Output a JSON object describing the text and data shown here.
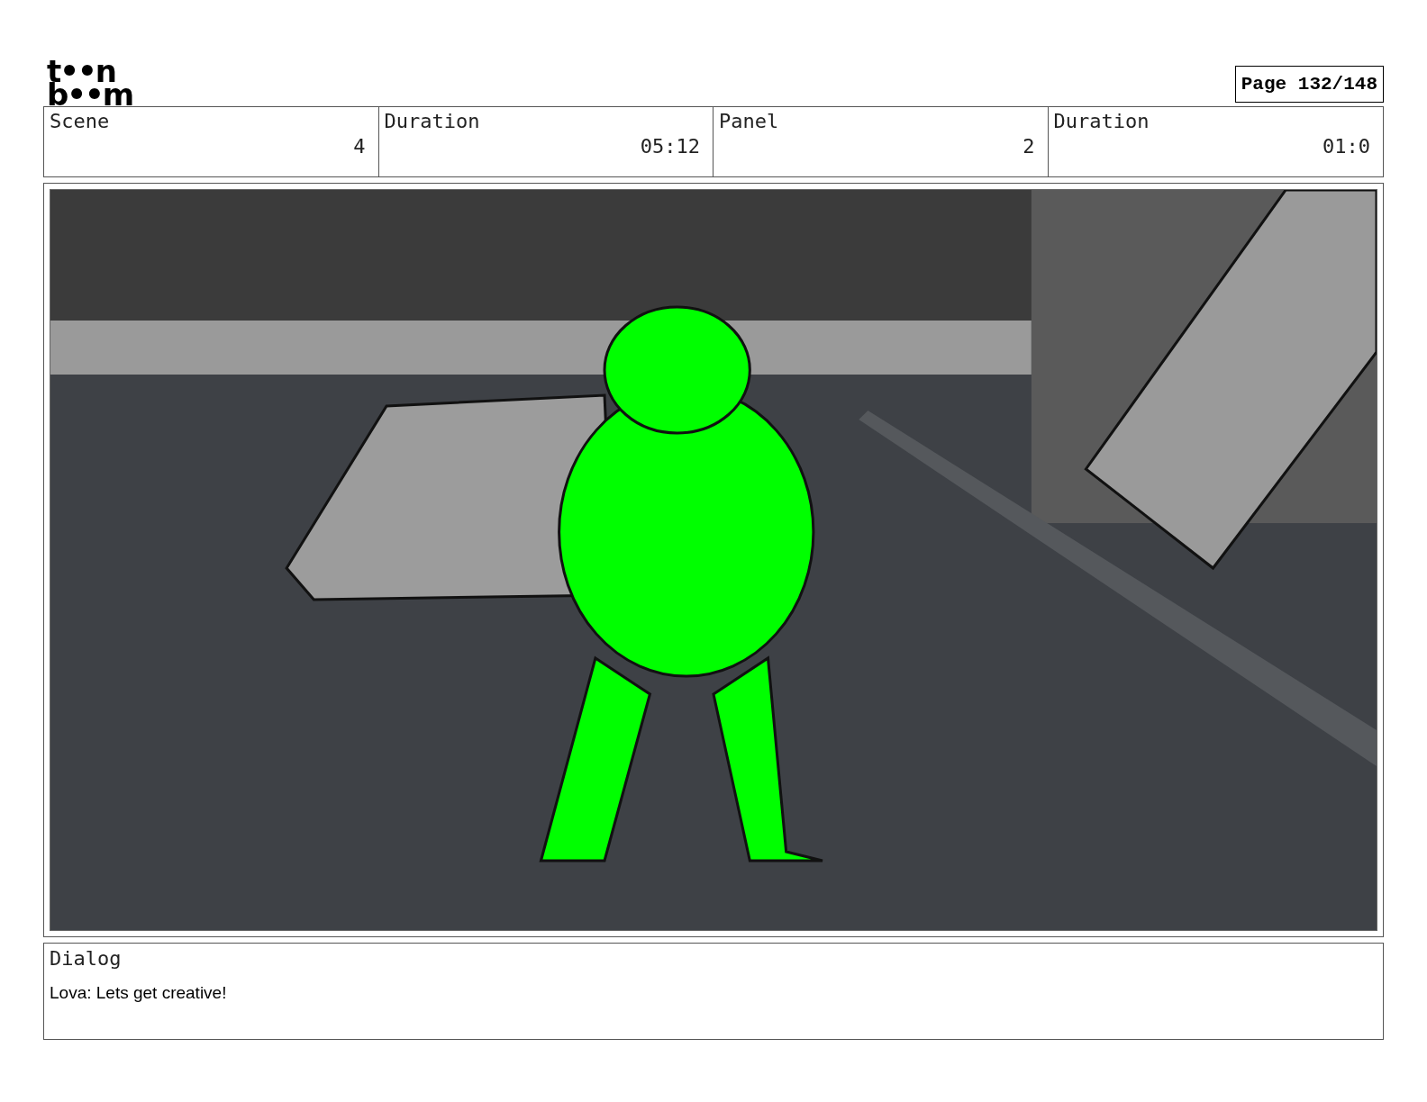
{
  "logo": {
    "top": "t••n",
    "bottom": "b••m"
  },
  "page_label": "Page 132/148",
  "header": [
    {
      "label": "Scene",
      "value": "4"
    },
    {
      "label": "Duration",
      "value": "05:12"
    },
    {
      "label": "Panel",
      "value": "2"
    },
    {
      "label": "Duration",
      "value": "01:0"
    }
  ],
  "dialog": {
    "label": "Dialog",
    "text": "Lova: Lets get creative!"
  }
}
